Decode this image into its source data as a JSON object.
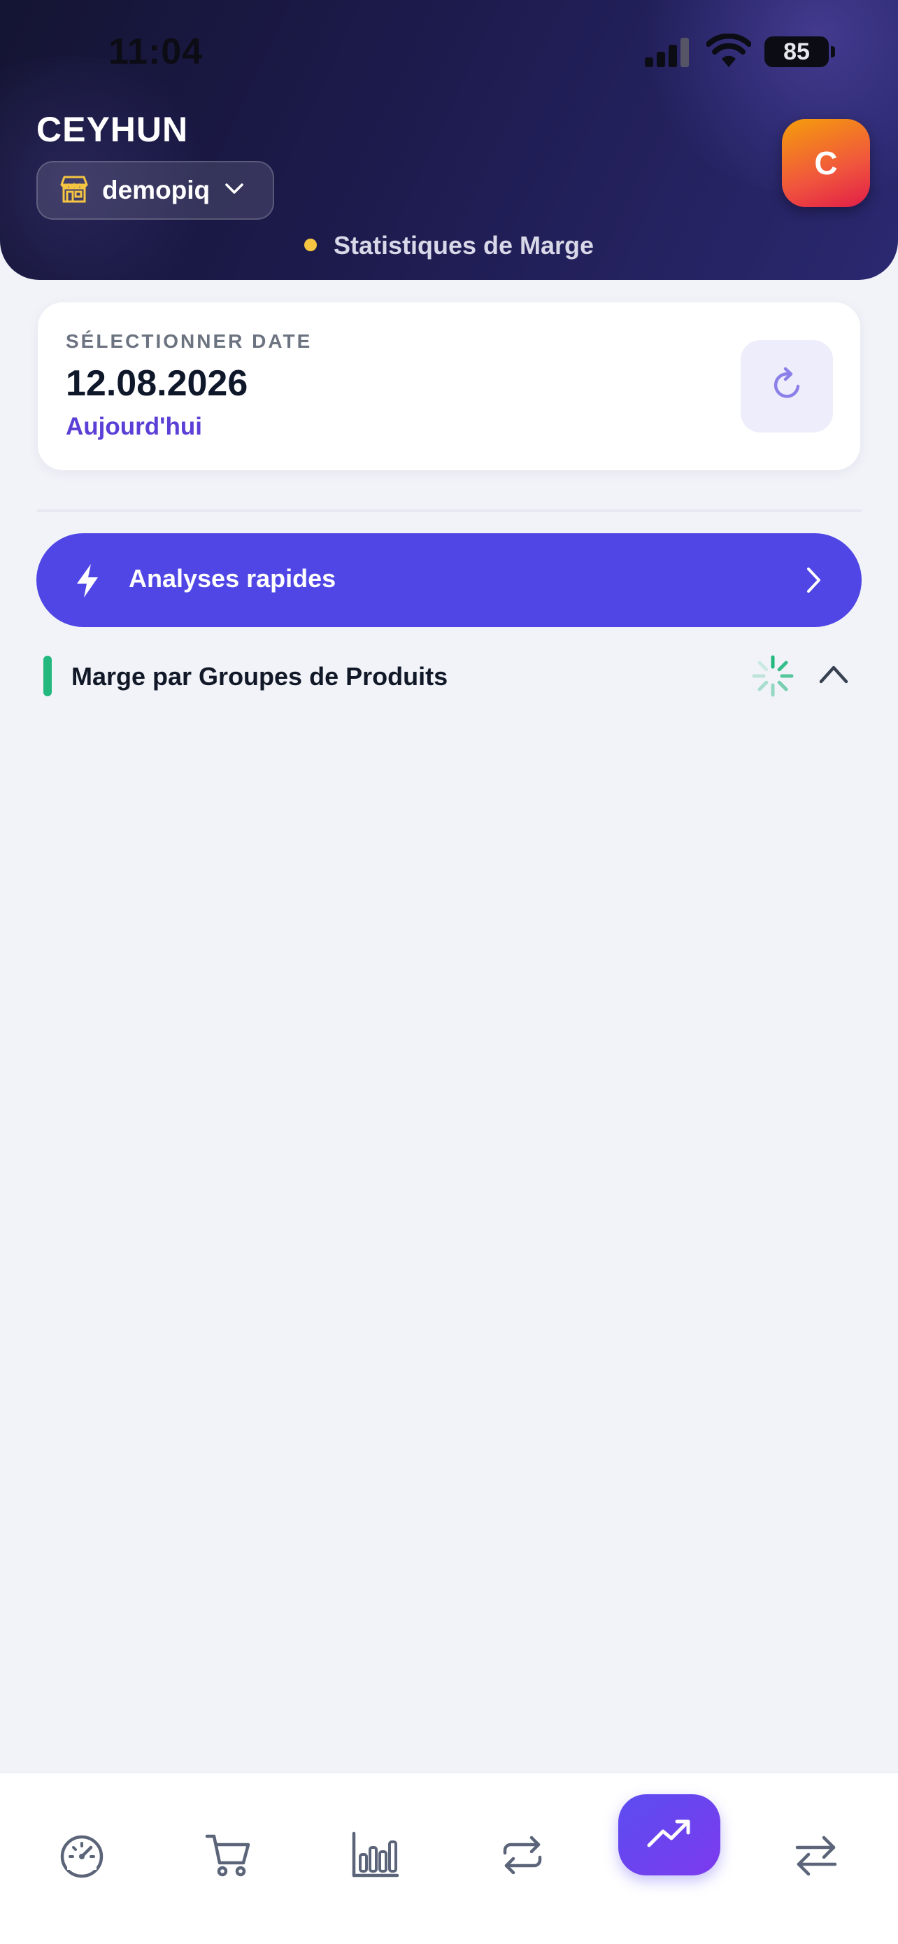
{
  "status_bar": {
    "time": "11:04",
    "battery": "85"
  },
  "header": {
    "user_name": "CEYHUN",
    "store": {
      "label": "demopiq",
      "icon": "store-icon"
    },
    "avatar_initial": "C",
    "subtitle": "Statistiques de Marge"
  },
  "date_card": {
    "label": "SÉLECTIONNER DATE",
    "date": "12.08.2026",
    "relative": "Aujourd'hui",
    "refresh_icon": "refresh-icon"
  },
  "quick_analysis": {
    "label": "Analyses rapides",
    "icon": "bolt-icon"
  },
  "section": {
    "title": "Marge par Groupes de Produits",
    "loading": true,
    "accent_color": "#22b87e"
  },
  "bottom_nav": {
    "items": [
      {
        "icon": "dashboard-gauge-icon",
        "active": false
      },
      {
        "icon": "cart-icon",
        "active": false
      },
      {
        "icon": "bar-chart-icon",
        "active": false
      },
      {
        "icon": "repeat-icon",
        "active": false
      },
      {
        "icon": "trending-up-icon",
        "active": true
      },
      {
        "icon": "transfer-arrows-icon",
        "active": false
      }
    ]
  },
  "colors": {
    "primary": "#4f46e5",
    "header_dark": "#1d1b4d",
    "accent_green": "#22b87e",
    "avatar_gradient": [
      "#f59e0b",
      "#e11d48"
    ],
    "background": "#f2f3f9"
  }
}
